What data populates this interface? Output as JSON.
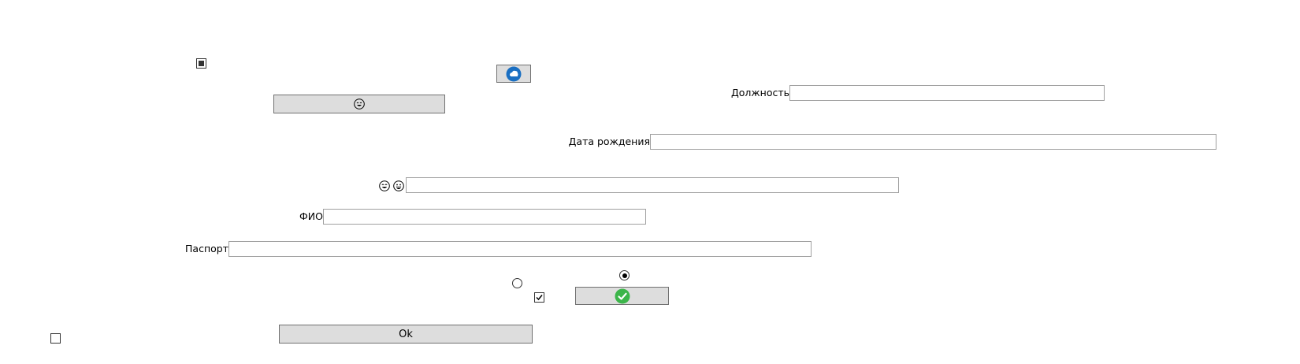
{
  "form": {
    "position_label": "Должность",
    "position_value": "",
    "birthdate_label": "Дата рождения",
    "birthdate_value": "",
    "emoji_field_value": "",
    "fio_label": "ФИО",
    "fio_value": "",
    "passport_label": "Паспорт",
    "passport_value": "",
    "ok_label": "Ok"
  },
  "controls": {
    "top_checkbox_state": "indeterminate",
    "bottom_left_checkbox_checked": false,
    "middle_checkbox_checked": true,
    "radio_left_selected": false,
    "radio_right_selected": true
  },
  "icons": {
    "top_image_button": "cloud-sync-icon",
    "emoji_button": "smiley-face-icon",
    "emoji_label_1": "laughing-face-icon",
    "emoji_label_2": "grinning-face-icon",
    "confirm_button": "green-check-icon"
  },
  "colors": {
    "button_bg": "#dddddd",
    "button_border": "#707070",
    "input_border": "#a0a0a0",
    "icon_blue": "#1a6fc2",
    "icon_green": "#3cb54a"
  }
}
